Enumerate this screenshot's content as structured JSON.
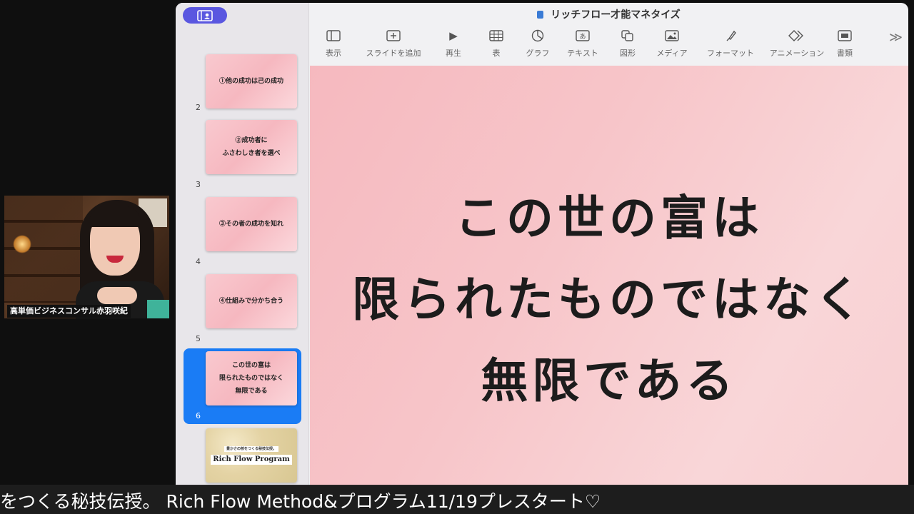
{
  "webcam": {
    "caption": "高単価ビジネスコンサル赤羽咲紀"
  },
  "window": {
    "title": "リッチフロー才能マネタイズ"
  },
  "toolbar": {
    "items": [
      {
        "label": "表示",
        "icon": "sidebar-view-icon"
      },
      {
        "label": "スライドを追加",
        "icon": "add-slide-icon"
      },
      {
        "label": "再生",
        "icon": "play-icon"
      },
      {
        "label": "表",
        "icon": "table-icon"
      },
      {
        "label": "グラフ",
        "icon": "chart-icon"
      },
      {
        "label": "テキスト",
        "icon": "text-box-icon"
      },
      {
        "label": "図形",
        "icon": "shape-icon"
      },
      {
        "label": "メディア",
        "icon": "media-icon"
      },
      {
        "label": "フォーマット",
        "icon": "format-brush-icon"
      },
      {
        "label": "アニメーション",
        "icon": "animation-icon"
      },
      {
        "label": "書類",
        "icon": "document-icon"
      }
    ],
    "more_icon": "chevron-double-right-icon"
  },
  "slides": [
    {
      "num": "2",
      "text": "①他の成功は己の成功"
    },
    {
      "num": "3",
      "text": "②成功者に\nふさわしき者を選べ"
    },
    {
      "num": "4",
      "text": "③その者の成功を知れ"
    },
    {
      "num": "5",
      "text": "④仕組みで分かち合う"
    },
    {
      "num": "6",
      "text": "この世の富は\n限られたものではなく\n無限である",
      "selected": true
    },
    {
      "num": "",
      "subtitle": "豊かさの核をつくる秘技伝授。",
      "title": "Rich Flow Program"
    }
  ],
  "main_slide": {
    "lines": [
      "この世の富は",
      "限られたものではなく",
      "無限である"
    ]
  },
  "ticker": {
    "text": "をつくる秘技伝授。 Rich Flow Method&プログラム11/19プレスタート♡"
  },
  "colors": {
    "accent": "#1a7cf5",
    "slide_bg": "#f7c5c9",
    "toggle": "#5a57e0"
  }
}
